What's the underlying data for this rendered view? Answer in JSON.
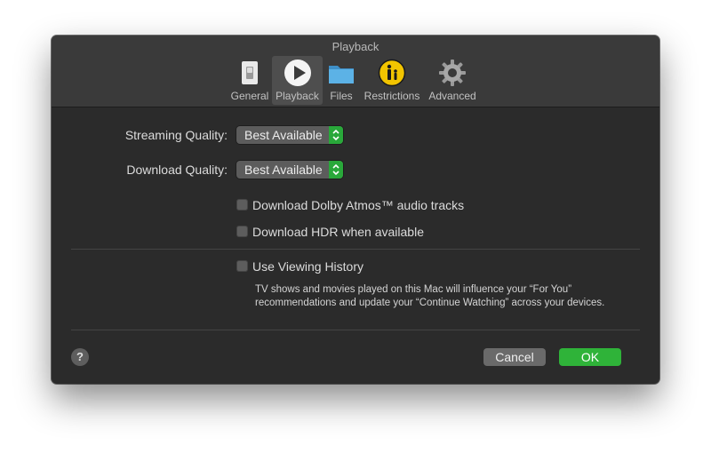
{
  "window": {
    "title": "Playback"
  },
  "toolbar": {
    "items": [
      {
        "label": "General",
        "icon": "general-switch-icon"
      },
      {
        "label": "Playback",
        "icon": "play-icon",
        "active": true
      },
      {
        "label": "Files",
        "icon": "folder-icon"
      },
      {
        "label": "Restrictions",
        "icon": "parental-restrictions-icon"
      },
      {
        "label": "Advanced",
        "icon": "gear-icon"
      }
    ]
  },
  "settings": {
    "streaming_quality": {
      "label": "Streaming Quality:",
      "value": "Best Available"
    },
    "download_quality": {
      "label": "Download Quality:",
      "value": "Best Available"
    },
    "dolby_atmos": {
      "label": "Download Dolby Atmos™ audio tracks",
      "checked": false
    },
    "hdr": {
      "label": "Download HDR when available",
      "checked": false
    },
    "viewing_history": {
      "label": "Use Viewing History",
      "checked": false,
      "description": "TV shows and movies played on this Mac will influence your “For You” recommendations and update your “Continue Watching” across your devices."
    }
  },
  "footer": {
    "help_label": "?",
    "cancel_label": "Cancel",
    "ok_label": "OK"
  },
  "colors": {
    "accent_green": "#2fb339",
    "window_bg": "#2b2b2b",
    "toolbar_bg": "#3a3a3a"
  }
}
